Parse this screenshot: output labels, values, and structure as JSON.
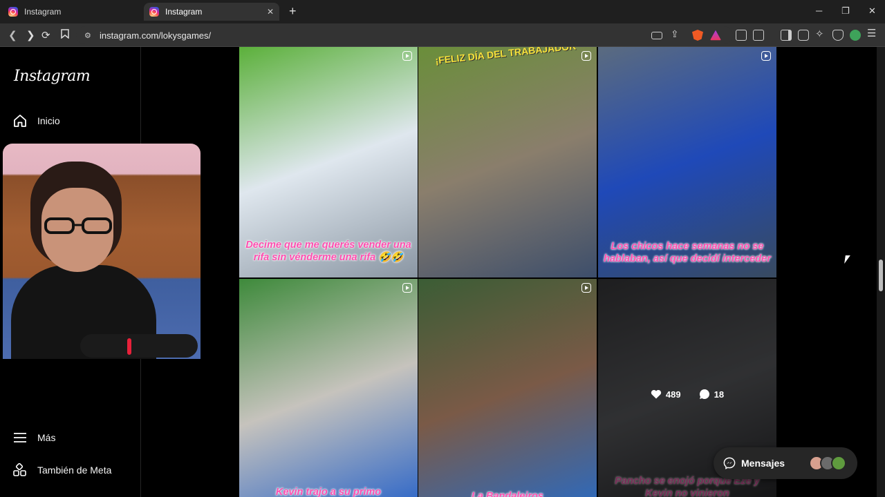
{
  "browser": {
    "tabs": [
      {
        "title": "Instagram",
        "active": false
      },
      {
        "title": "Instagram",
        "active": true
      }
    ],
    "url": "instagram.com/lokysgames/",
    "icons": [
      "back-icon",
      "forward-icon",
      "reload-icon",
      "bookmark-icon",
      "site-info-icon",
      "install-icon",
      "share-icon",
      "brave-shield-icon",
      "brave-rewards-icon",
      "extensions-icon",
      "sidebar-icon",
      "wallet-icon",
      "leo-icon",
      "vpn-icon",
      "menu-icon"
    ]
  },
  "sidebar": {
    "logo": "Instagram",
    "top_items": [
      {
        "label": "Inicio",
        "icon": "home-icon"
      }
    ],
    "bottom_items": [
      {
        "label": "Más",
        "icon": "hamburger-icon"
      },
      {
        "label": "También de Meta",
        "icon": "meta-apps-icon"
      }
    ]
  },
  "grid": {
    "tiles": [
      {
        "caption": "Decime que me querés vender una rifa sin vénderme una rifa 🤣🤣",
        "colors": [
          "#5bb03a",
          "#dfe7ee",
          "#8a96a3"
        ]
      },
      {
        "caption": "",
        "banner": "¡FELIZ DÍA DEL TRABAJADOR",
        "colors": [
          "#6a8e3a",
          "#8a7e6c",
          "#3d4e6b"
        ]
      },
      {
        "caption": "Los chicos hace semanas no se hablaban, así que decidí interceder",
        "colors": [
          "#5b6b7f",
          "#1f49b8",
          "#384a60"
        ]
      },
      {
        "caption": "Kevin trajo a su primo",
        "colors": [
          "#3e8a3b",
          "#c6c3bd",
          "#2a64c8"
        ]
      },
      {
        "caption": "La Bandaleiros",
        "colors": [
          "#3b5d35",
          "#7a5a47",
          "#2b6ac0"
        ]
      },
      {
        "caption": "Pancho se enojó porque Eze y Kevin no vinieron",
        "colors": [
          "#2f2f31",
          "#4a4b4e",
          "#1d1d1f"
        ],
        "hover": {
          "likes": "489",
          "comments": "18"
        }
      }
    ]
  },
  "messages_button": {
    "label": "Mensajes"
  }
}
